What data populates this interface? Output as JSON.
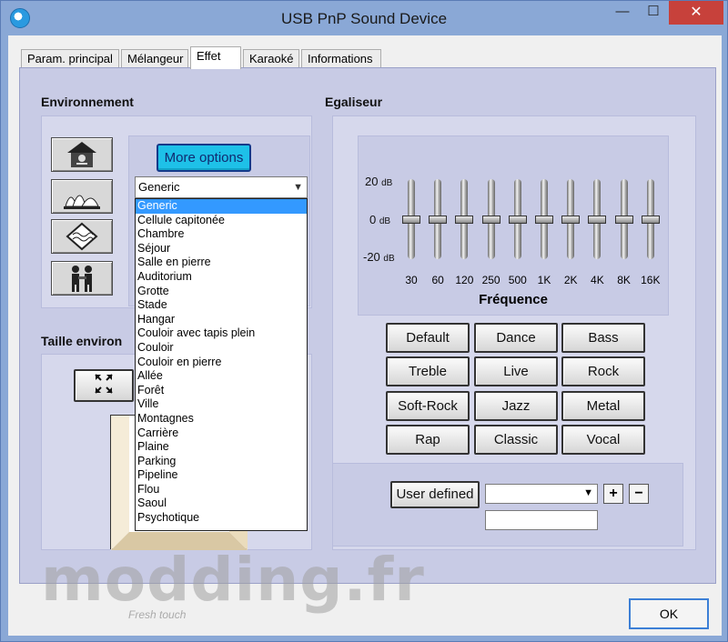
{
  "window": {
    "title": "USB PnP Sound Device",
    "minimize_label": "—",
    "maximize_label": "☐",
    "close_label": "✕"
  },
  "tabs": [
    {
      "label": "Param. principal"
    },
    {
      "label": "Mélangeur"
    },
    {
      "label": "Effet"
    },
    {
      "label": "Karaoké"
    },
    {
      "label": "Informations"
    }
  ],
  "environment": {
    "heading": "Environnement",
    "more_options_label": "More options",
    "selected": "Generic",
    "options": [
      "Generic",
      "Cellule capitonée",
      "Chambre",
      "Séjour",
      "Salle en pierre",
      "Auditorium",
      "Grotte",
      "Stade",
      "Hangar",
      "Couloir avec tapis plein",
      "Couloir",
      "Couloir en pierre",
      "Allée",
      "Forêt",
      "Ville",
      "Montagnes",
      "Carrière",
      "Plaine",
      "Parking",
      "Pipeline",
      "Flou",
      "Saoul",
      "Psychotique"
    ],
    "icons": [
      "bathroom-icon",
      "opera-house-icon",
      "underwater-icon",
      "people-icon"
    ]
  },
  "size": {
    "heading": "Taille environ"
  },
  "equalizer": {
    "heading": "Egaliseur",
    "db_labels": [
      {
        "value": "20",
        "unit": "dB"
      },
      {
        "value": "0",
        "unit": "dB"
      },
      {
        "value": "-20",
        "unit": "dB"
      }
    ],
    "frequencies": [
      "30",
      "60",
      "120",
      "250",
      "500",
      "1K",
      "2K",
      "4K",
      "8K",
      "16K"
    ],
    "band_levels_db": [
      0,
      0,
      0,
      0,
      0,
      0,
      0,
      0,
      0,
      0
    ],
    "frequency_title": "Fréquence",
    "presets": [
      "Default",
      "Dance",
      "Bass",
      "Treble",
      "Live",
      "Rock",
      "Soft-Rock",
      "Jazz",
      "Metal",
      "Rap",
      "Classic",
      "Vocal"
    ],
    "user_defined_label": "User defined",
    "user_defined_value": "",
    "name_value": "",
    "plus_label": "+",
    "minus_label": "−"
  },
  "footer": {
    "ok_label": "OK"
  },
  "watermark": {
    "text": "modding.fr",
    "subtext": "Fresh touch"
  },
  "colors": {
    "panel": "#c8cbe5",
    "accent": "#1ec1e8",
    "selection": "#3399ff",
    "close": "#c7413b"
  }
}
